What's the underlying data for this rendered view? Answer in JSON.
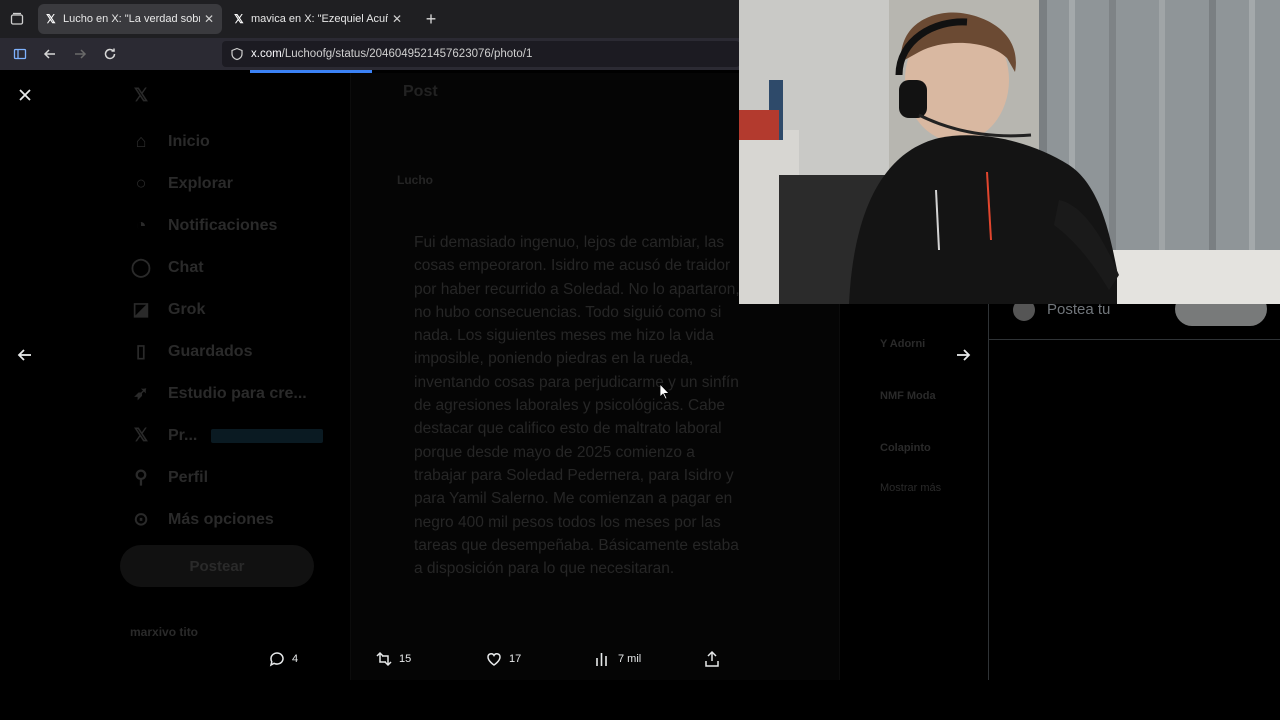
{
  "browser": {
    "tabs": [
      {
        "title": "Lucho en X: \"La verdad sobre Is",
        "active": true
      },
      {
        "title": "mavica en X: \"Ezequiel Acuña, u",
        "active": false
      }
    ],
    "url_host": "x.com",
    "url_path": "/Luchoofg/status/2046049521457623076/photo/1",
    "new_tab_label": "+"
  },
  "background_page": {
    "nav_items": [
      "Inicio",
      "Explorar",
      "Notificaciones",
      "Chat",
      "Grok",
      "Guardados",
      "Estudio para cre...",
      "Pr...",
      "Perfil",
      "Más opciones"
    ],
    "post_button": "Postear",
    "account_name": "marxivo tito",
    "post_header": "Post",
    "author": "Lucho",
    "post_text": "Fui demasiado ingenuo, lejos de cambiar, las cosas empeoraron. Isidro me acusó de traidor por haber recurrido a Soledad. No lo apartaron, no hubo consecuencias. Todo siguió como si nada. Los siguientes meses me hizo la vida imposible, poniendo piedras en la rueda, inventando cosas para perjudicarme y un sinfín de agresiones laborales y psicológicas. Cabe destacar que califico esto de maltrato laboral porque desde mayo de 2025 comienzo a trabajar para Soledad Pedernera, para Isidro y para Yamil Salerno. Me comienzan a pagar en negro 400 mil pesos todos los meses por las tareas que desempeñaba. Básicamente estaba a disposición para lo que necesitaran.",
    "trends": [
      "Y Adorni",
      "NMF Moda",
      "Colapinto",
      "Mostrar más"
    ]
  },
  "reply": {
    "placeholder": "Postea tu"
  },
  "actions": {
    "replies": "4",
    "reposts": "15",
    "likes": "17",
    "views": "7 mil"
  },
  "colors": {
    "accent": "#3b82f6",
    "text": "#e7e9ea",
    "muted": "#71767b"
  }
}
